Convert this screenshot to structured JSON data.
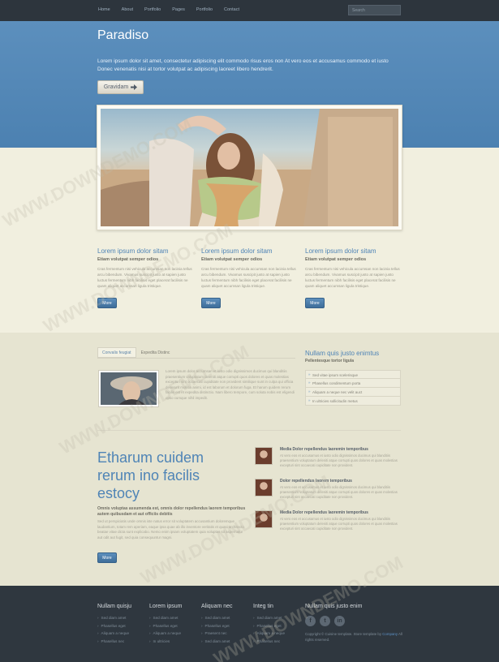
{
  "nav": {
    "items": [
      "Home",
      "About",
      "Portfolio",
      "Pages",
      "Portfolio",
      "Contact"
    ],
    "search_placeholder": "Search"
  },
  "hero": {
    "title": "Paradiso",
    "text": "Lorem ipsum dolor sit amet, consectetur adipiscing elit commodo risus eros non At vero eos et accusamus commodo et iusto Donec venenatis nisi at tortor volutpat ac adipiscing laoreet libero hendrerit.",
    "button": "Gravidam"
  },
  "features": [
    {
      "title": "Lorem ipsum dolor sitam",
      "subtitle": "Etiam volutpat semper odios",
      "text": "Cras fermentum nisi vehicula accumsan non lacinia tellus arcu bibendum. Vivamus suscipit justo at sapien justo luctus fermentum nibh facilisis eget placerat facilisis ne quam aliquet accumsan ligula tristique.",
      "button": "More"
    },
    {
      "title": "Lorem ipsum dolor sitam",
      "subtitle": "Etiam volutpat semper odios",
      "text": "Cras fermentum nisi vehicula accumsan non lacinia tellus arcu bibendum. Vivamus suscipit justo at sapien justo luctus fermentum nibh facilisis eget placerat facilisis ne quam aliquet accumsan ligula tristique.",
      "button": "More"
    },
    {
      "title": "Lorem ipsum dolor sitam",
      "subtitle": "Etiam volutpat semper odios",
      "text": "Cras fermentum nisi vehicula accumsan non lacinia tellus arcu bibendum. Vivamus suscipit justo at sapien justo luctus fermentum nibh facilisis eget placerat facilisis ne quam aliquet accumsan ligula tristique.",
      "button": "More"
    }
  ],
  "tabs": {
    "items": [
      "Convalis feugiat",
      "Expedita Distinc"
    ],
    "text": "Lorem ipsum dolor accumsan et iusto odio dignissimos ducimus qui blanditiis praesentium voluptatum deleniti atque corrupti quos dolores et quas molestias excepturi sint occaecati cupiditate non provident similique sunt in culpa qui officia deserunt mollitia animi, id est laborum et dolorum fuga. Et harum quidem rerum facilis est et expedita distinctio. Nam libero tempore, cum soluta nobis est eligendi optio cumque nihil impedit."
  },
  "sidebar": {
    "title": "Nullam quis justo enimtus",
    "subtitle": "Pellentesque tortor ligula",
    "items": [
      "Sed vitae ipsum scelerisque",
      "Phasellus condimentum porta",
      "Aliquam a neque nec velit auct",
      "In ultricies sollicitudin metus"
    ]
  },
  "feature2": {
    "title": "Etharum cuidem rerum ino facilis estocy",
    "subtitle": "Omnis voluptas assumenda est, omnis dolor repellendus laorem temporibus autem quibusdam et aut officiis debitis",
    "text": "Sed ut perspiciatis unde omnis iste natus error sit voluptatem accusantium doloremque laudantium, totam rem aperiam, eaque ipsa quae ab illo inventore veritatis et quasi architecto beatae vitae dicta sunt explicabo. Nemo enim ipsam voluptatem quia voluptas sit aspernatur aut odit aut fugit, sed quia consequuntur magni.",
    "button": "More"
  },
  "media": [
    {
      "title": "Media Dolor repellendus laoremin temporibus",
      "text": "At vero eos et accusamus et iusto odio dignissimos ducimus qui blanditiis praesentium voluptatum deleniti atque corrupti quos dolores et quas molestias excepturi sint occaecati cupiditate non provident."
    },
    {
      "title": "Dolor repellendus laorem temporibus",
      "text": "At vero eos et accusamus et iusto odio dignissimos ducimus qui blanditiis praesentium voluptatum deleniti atque corrupti quos dolores et quas molestias excepturi sint occaecati cupiditate non provident."
    },
    {
      "title": "Media Dolor repellendus laoremin temporibus",
      "text": "At vero eos et accusamus et iusto odio dignissimos ducimus qui blanditiis praesentium voluptatum deleniti atque corrupti quos dolores et quas molestias excepturi sint occaecati cupiditate non provident."
    }
  ],
  "footer": {
    "cols": [
      {
        "title": "Nullam quisju",
        "links": [
          "Sed diam amet",
          "Phasellus eget",
          "Aliquam a neque",
          "Phasellus nec"
        ]
      },
      {
        "title": "Lorem ipsum",
        "links": [
          "Sed diam amet",
          "Phasellus eget",
          "Aliquam a neque",
          "In ultricies"
        ]
      },
      {
        "title": "Aliquam nec",
        "links": [
          "Sed diam amet",
          "Phasellus eget",
          "Praesent nec",
          "Sed diam amet"
        ]
      },
      {
        "title": "Integ tin",
        "links": [
          "Sed diam amet",
          "Phasellus eget",
          "Aliquam a neque",
          "Phasellus nec"
        ]
      }
    ],
    "social_title": "Nullam quis justo enim",
    "social": [
      "f",
      "t",
      "in"
    ],
    "copyright": "Copyright © Cuisine template. Store template by",
    "copyright_link": "Company",
    "copyright_tail": "All rights reserved."
  },
  "watermark": "WWW.DOWNDEMO.COM"
}
